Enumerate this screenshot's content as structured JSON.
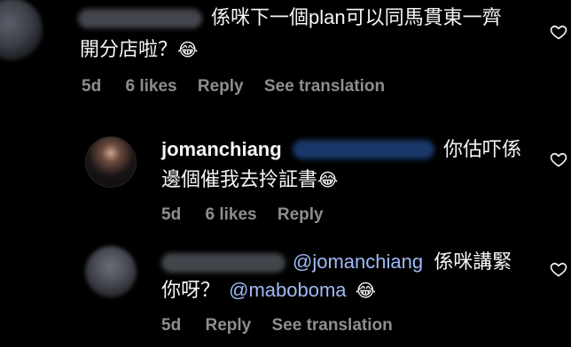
{
  "comments": [
    {
      "line1": "係咪下一個plan可以同馬貫東一齊",
      "line2": "開分店啦？",
      "emoji": "😂",
      "time": "5d",
      "likes": "6 likes",
      "reply": "Reply",
      "translate": "See translation"
    },
    {
      "username": "jomanchiang",
      "line1": "你估吓係",
      "line2": "邊個催我去拎証書",
      "emoji": "😂",
      "time": "5d",
      "likes": "6 likes",
      "reply": "Reply"
    },
    {
      "mention1": "@jomanchiang",
      "line1": "係咪講緊",
      "line2a": "你呀？",
      "mention2": "@maboboma",
      "emoji": "😂",
      "time": "5d",
      "reply": "Reply",
      "translate": "See translation"
    }
  ],
  "icons": {
    "like": "heart-outline-icon"
  }
}
